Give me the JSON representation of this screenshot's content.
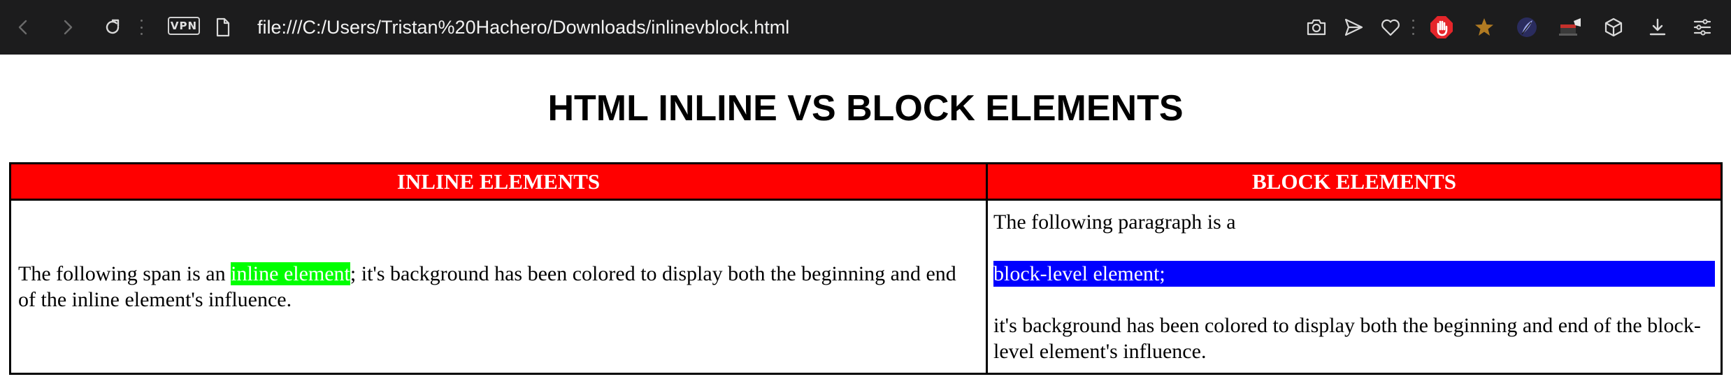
{
  "browser": {
    "vpn_label": "VPN",
    "url": "file:///C:/Users/Tristan%20Hachero/Downloads/inlinevblock.html",
    "icons": [
      "back-arrow-icon",
      "forward-arrow-icon",
      "reload-icon",
      "vpn-badge",
      "page-icon",
      "camera-icon",
      "send-icon",
      "heart-icon",
      "adblock-icon",
      "star-icon",
      "feather-icon",
      "extension-icon",
      "cube-icon",
      "download-icon",
      "menu-icon"
    ],
    "colors": {
      "toolbar_bg": "#1c1c1d",
      "adblock_red": "#e5252a",
      "star_gold": "#b07a22"
    }
  },
  "page": {
    "heading": "HTML INLINE VS BLOCK ELEMENTS",
    "table": {
      "headers": [
        "INLINE ELEMENTS",
        "BLOCK ELEMENTS"
      ],
      "header_bg": "#ff0000",
      "inline_cell": {
        "before": "The following span is an ",
        "highlight": "inline element",
        "after": "; it's background has been colored to display both the beginning and end of the inline element's influence.",
        "highlight_color": "#00ff00"
      },
      "block_cell": {
        "p1": "The following paragraph is a",
        "p2": "block-level element;",
        "p3": "it's background has been colored to display both the beginning and end of the block-level element's influence.",
        "highlight_color": "#0000ff"
      }
    }
  }
}
